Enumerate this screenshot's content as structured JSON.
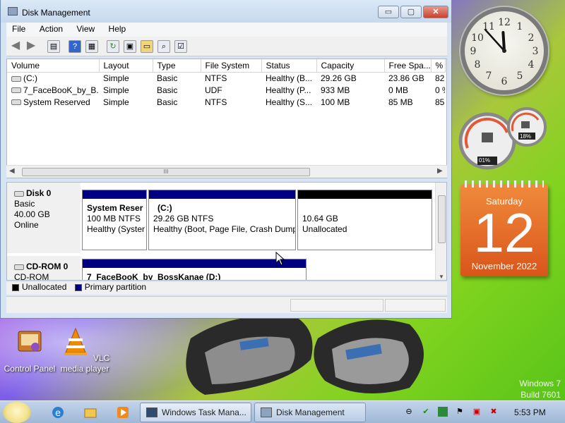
{
  "window": {
    "title": "Disk Management",
    "buttons": {
      "minimize": "▭",
      "maximize": "▢",
      "close": "✕"
    }
  },
  "menu": [
    "File",
    "Action",
    "View",
    "Help"
  ],
  "volume_table": {
    "columns": [
      "Volume",
      "Layout",
      "Type",
      "File System",
      "Status",
      "Capacity",
      "Free Spa...",
      "% F"
    ],
    "rows": [
      {
        "volume": "(C:)",
        "layout": "Simple",
        "type": "Basic",
        "fs": "NTFS",
        "status": "Healthy (B...",
        "capacity": "29.26 GB",
        "free": "23.86 GB",
        "pct": "82"
      },
      {
        "volume": "7_FaceBooK_by_B...",
        "layout": "Simple",
        "type": "Basic",
        "fs": "UDF",
        "status": "Healthy (P...",
        "capacity": "933 MB",
        "free": "0 MB",
        "pct": "0 %"
      },
      {
        "volume": "System Reserved",
        "layout": "Simple",
        "type": "Basic",
        "fs": "NTFS",
        "status": "Healthy (S...",
        "capacity": "100 MB",
        "free": "85 MB",
        "pct": "85"
      }
    ]
  },
  "scroll_grip": "III",
  "disks": {
    "disk0": {
      "name": "Disk 0",
      "type": "Basic",
      "size": "40.00 GB",
      "state": "Online",
      "partitions": [
        {
          "title": "System Reser",
          "size": "100 MB NTFS",
          "status": "Healthy (Syster",
          "color": "#000080"
        },
        {
          "title": "(C:)",
          "size": "29.26 GB NTFS",
          "status": "Healthy (Boot, Page File, Crash Dump",
          "color": "#000080"
        },
        {
          "title": "",
          "size": "10.64 GB",
          "status": "Unallocated",
          "color": "#000000"
        }
      ]
    },
    "cdrom0": {
      "name": "CD-ROM 0",
      "type": "CD-ROM",
      "partition_title": "7_FaceBooK_by_BossKanae (D:)"
    }
  },
  "legend": [
    {
      "label": "Unallocated",
      "color": "#000000"
    },
    {
      "label": "Primary partition",
      "color": "#000080"
    }
  ],
  "gadgets": {
    "clock": {
      "hour": 11,
      "minute": 53
    },
    "cpu_meter": {
      "cpu": "01%",
      "memory": "18%"
    },
    "calendar": {
      "day_name": "Saturday",
      "day": "12",
      "month_year": "November 2022"
    }
  },
  "desktop_icons": [
    {
      "label": "Control Panel",
      "icon": "control-panel-icon"
    },
    {
      "label": "VLC media player",
      "icon": "vlc-icon"
    }
  ],
  "watermark": {
    "line1": "Windows 7",
    "line2": "Build 7601"
  },
  "taskbar": {
    "tasks": [
      {
        "label": "Windows Task Mana...",
        "active": false
      },
      {
        "label": "Disk Management",
        "active": true
      }
    ],
    "time": "5:53 PM"
  }
}
